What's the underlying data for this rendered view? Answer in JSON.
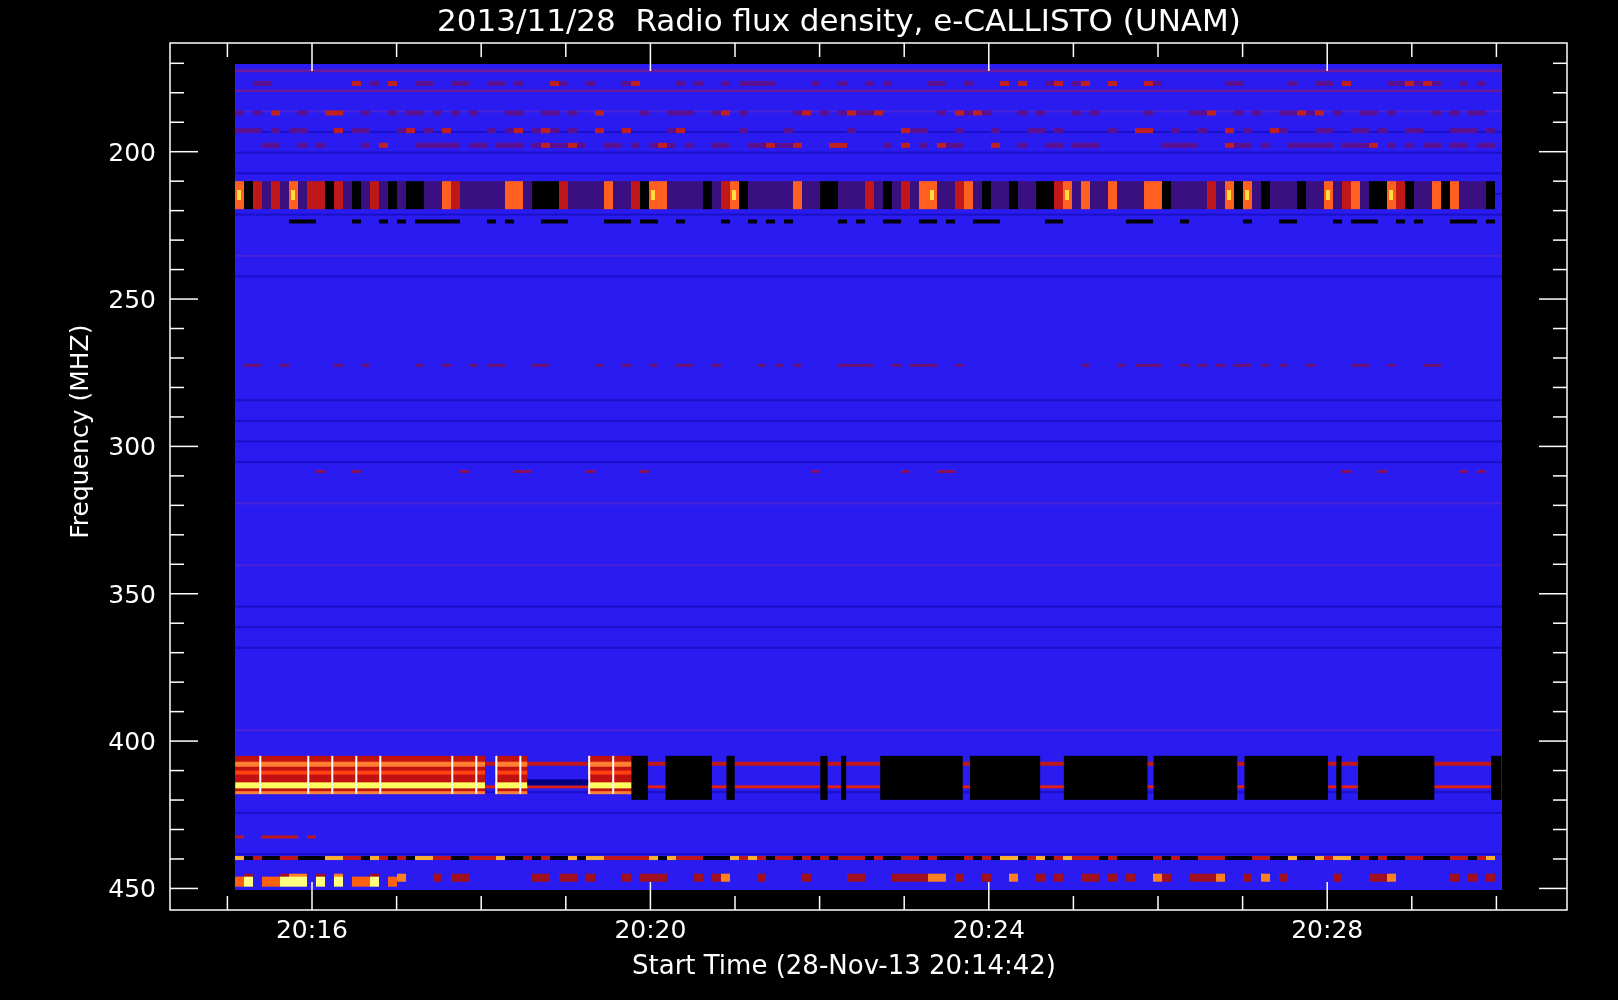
{
  "chart": {
    "title": "2013/11/28  Radio flux density, e-CALLISTO (UNAM)",
    "ylabel": "Frequency (MHZ)",
    "xlabel": "Start Time (28-Nov-13 20:14:42)",
    "yticks": [
      "200",
      "250",
      "300",
      "350",
      "400",
      "450"
    ],
    "xticks": [
      "20:16",
      "20:20",
      "20:24",
      "20:28"
    ]
  }
}
